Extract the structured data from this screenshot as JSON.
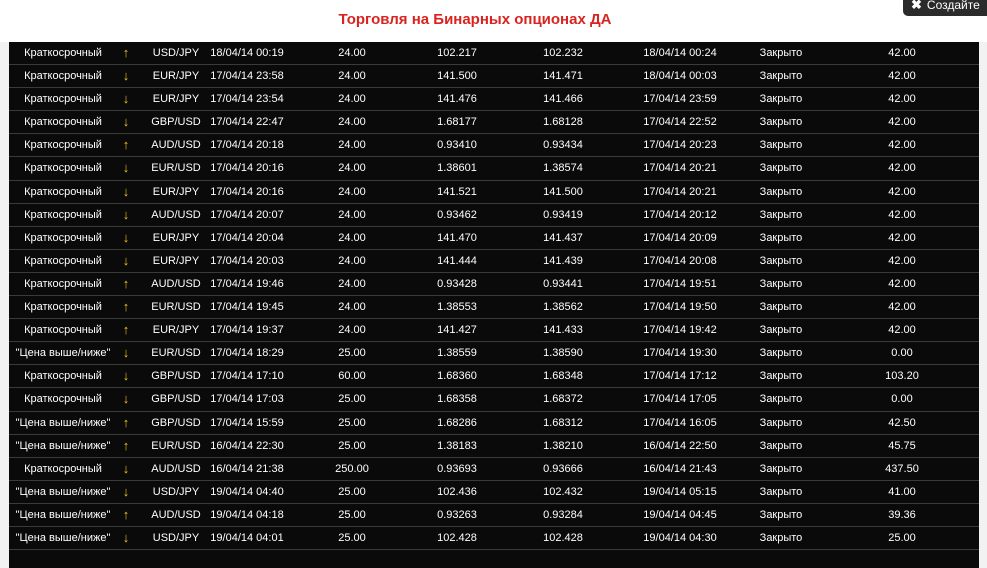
{
  "page": {
    "title": "Торговля на Бинарных опционах ДА",
    "create_button": "Создайте"
  },
  "colors": {
    "title": "#d9231f",
    "table_bg": "#0a0a0a",
    "arrow": "#f2c21b",
    "text": "#ffffff"
  },
  "icons": {
    "up": "↑",
    "down": "↓",
    "close": "✖"
  },
  "rows": [
    {
      "type": "Краткосрочный",
      "dir": "up",
      "pair": "USD/JPY",
      "open_time": "18/04/14 00:19",
      "amount": "24.00",
      "open_price": "102.217",
      "close_price": "102.232",
      "close_time": "18/04/14 00:24",
      "status": "Закрыто",
      "payout": "42.00"
    },
    {
      "type": "Краткосрочный",
      "dir": "down",
      "pair": "EUR/JPY",
      "open_time": "17/04/14 23:58",
      "amount": "24.00",
      "open_price": "141.500",
      "close_price": "141.471",
      "close_time": "18/04/14 00:03",
      "status": "Закрыто",
      "payout": "42.00"
    },
    {
      "type": "Краткосрочный",
      "dir": "down",
      "pair": "EUR/JPY",
      "open_time": "17/04/14 23:54",
      "amount": "24.00",
      "open_price": "141.476",
      "close_price": "141.466",
      "close_time": "17/04/14 23:59",
      "status": "Закрыто",
      "payout": "42.00"
    },
    {
      "type": "Краткосрочный",
      "dir": "down",
      "pair": "GBP/USD",
      "open_time": "17/04/14 22:47",
      "amount": "24.00",
      "open_price": "1.68177",
      "close_price": "1.68128",
      "close_time": "17/04/14 22:52",
      "status": "Закрыто",
      "payout": "42.00"
    },
    {
      "type": "Краткосрочный",
      "dir": "up",
      "pair": "AUD/USD",
      "open_time": "17/04/14 20:18",
      "amount": "24.00",
      "open_price": "0.93410",
      "close_price": "0.93434",
      "close_time": "17/04/14 20:23",
      "status": "Закрыто",
      "payout": "42.00"
    },
    {
      "type": "Краткосрочный",
      "dir": "down",
      "pair": "EUR/USD",
      "open_time": "17/04/14 20:16",
      "amount": "24.00",
      "open_price": "1.38601",
      "close_price": "1.38574",
      "close_time": "17/04/14 20:21",
      "status": "Закрыто",
      "payout": "42.00"
    },
    {
      "type": "Краткосрочный",
      "dir": "down",
      "pair": "EUR/JPY",
      "open_time": "17/04/14 20:16",
      "amount": "24.00",
      "open_price": "141.521",
      "close_price": "141.500",
      "close_time": "17/04/14 20:21",
      "status": "Закрыто",
      "payout": "42.00"
    },
    {
      "type": "Краткосрочный",
      "dir": "down",
      "pair": "AUD/USD",
      "open_time": "17/04/14 20:07",
      "amount": "24.00",
      "open_price": "0.93462",
      "close_price": "0.93419",
      "close_time": "17/04/14 20:12",
      "status": "Закрыто",
      "payout": "42.00"
    },
    {
      "type": "Краткосрочный",
      "dir": "down",
      "pair": "EUR/JPY",
      "open_time": "17/04/14 20:04",
      "amount": "24.00",
      "open_price": "141.470",
      "close_price": "141.437",
      "close_time": "17/04/14 20:09",
      "status": "Закрыто",
      "payout": "42.00"
    },
    {
      "type": "Краткосрочный",
      "dir": "down",
      "pair": "EUR/JPY",
      "open_time": "17/04/14 20:03",
      "amount": "24.00",
      "open_price": "141.444",
      "close_price": "141.439",
      "close_time": "17/04/14 20:08",
      "status": "Закрыто",
      "payout": "42.00"
    },
    {
      "type": "Краткосрочный",
      "dir": "up",
      "pair": "AUD/USD",
      "open_time": "17/04/14 19:46",
      "amount": "24.00",
      "open_price": "0.93428",
      "close_price": "0.93441",
      "close_time": "17/04/14 19:51",
      "status": "Закрыто",
      "payout": "42.00"
    },
    {
      "type": "Краткосрочный",
      "dir": "up",
      "pair": "EUR/USD",
      "open_time": "17/04/14 19:45",
      "amount": "24.00",
      "open_price": "1.38553",
      "close_price": "1.38562",
      "close_time": "17/04/14 19:50",
      "status": "Закрыто",
      "payout": "42.00"
    },
    {
      "type": "Краткосрочный",
      "dir": "up",
      "pair": "EUR/JPY",
      "open_time": "17/04/14 19:37",
      "amount": "24.00",
      "open_price": "141.427",
      "close_price": "141.433",
      "close_time": "17/04/14 19:42",
      "status": "Закрыто",
      "payout": "42.00"
    },
    {
      "type": "\"Цена выше/ниже\"",
      "dir": "down",
      "pair": "EUR/USD",
      "open_time": "17/04/14 18:29",
      "amount": "25.00",
      "open_price": "1.38559",
      "close_price": "1.38590",
      "close_time": "17/04/14 19:30",
      "status": "Закрыто",
      "payout": "0.00"
    },
    {
      "type": "Краткосрочный",
      "dir": "down",
      "pair": "GBP/USD",
      "open_time": "17/04/14 17:10",
      "amount": "60.00",
      "open_price": "1.68360",
      "close_price": "1.68348",
      "close_time": "17/04/14 17:12",
      "status": "Закрыто",
      "payout": "103.20"
    },
    {
      "type": "Краткосрочный",
      "dir": "down",
      "pair": "GBP/USD",
      "open_time": "17/04/14 17:03",
      "amount": "25.00",
      "open_price": "1.68358",
      "close_price": "1.68372",
      "close_time": "17/04/14 17:05",
      "status": "Закрыто",
      "payout": "0.00"
    },
    {
      "type": "\"Цена выше/ниже\"",
      "dir": "up",
      "pair": "GBP/USD",
      "open_time": "17/04/14 15:59",
      "amount": "25.00",
      "open_price": "1.68286",
      "close_price": "1.68312",
      "close_time": "17/04/14 16:05",
      "status": "Закрыто",
      "payout": "42.50"
    },
    {
      "type": "\"Цена выше/ниже\"",
      "dir": "up",
      "pair": "EUR/USD",
      "open_time": "16/04/14 22:30",
      "amount": "25.00",
      "open_price": "1.38183",
      "close_price": "1.38210",
      "close_time": "16/04/14 22:50",
      "status": "Закрыто",
      "payout": "45.75"
    },
    {
      "type": "Краткосрочный",
      "dir": "down",
      "pair": "AUD/USD",
      "open_time": "16/04/14 21:38",
      "amount": "250.00",
      "open_price": "0.93693",
      "close_price": "0.93666",
      "close_time": "16/04/14 21:43",
      "status": "Закрыто",
      "payout": "437.50"
    },
    {
      "type": "\"Цена выше/ниже\"",
      "dir": "down",
      "pair": "USD/JPY",
      "open_time": "19/04/14 04:40",
      "amount": "25.00",
      "open_price": "102.436",
      "close_price": "102.432",
      "close_time": "19/04/14 05:15",
      "status": "Закрыто",
      "payout": "41.00"
    },
    {
      "type": "\"Цена выше/ниже\"",
      "dir": "up",
      "pair": "AUD/USD",
      "open_time": "19/04/14 04:18",
      "amount": "25.00",
      "open_price": "0.93263",
      "close_price": "0.93284",
      "close_time": "19/04/14 04:45",
      "status": "Закрыто",
      "payout": "39.36"
    },
    {
      "type": "\"Цена выше/ниже\"",
      "dir": "down",
      "pair": "USD/JPY",
      "open_time": "19/04/14 04:01",
      "amount": "25.00",
      "open_price": "102.428",
      "close_price": "102.428",
      "close_time": "19/04/14 04:30",
      "status": "Закрыто",
      "payout": "25.00"
    }
  ]
}
